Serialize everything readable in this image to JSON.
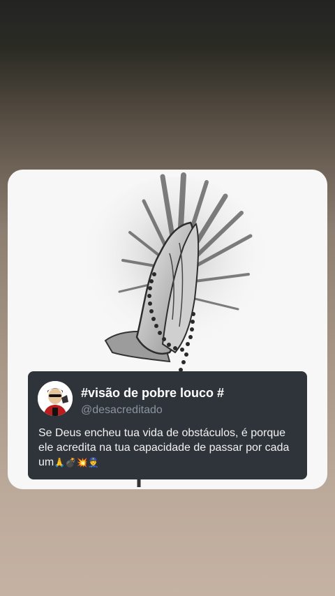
{
  "post": {
    "display_name": "#visão de pobre louco #",
    "handle": "@desacreditado",
    "text": "Se Deus encheu tua vida de obstáculos, é porque ele acredita na tua capacidade de passar por cada um",
    "emojis": "🙏💣💥👮"
  },
  "colors": {
    "card_bg": "#f7f7f7",
    "tweet_bg": "#2f343b",
    "handle": "#8c949d"
  },
  "icons": {
    "illustration": "praying-hands-with-rosary",
    "avatar": "cartoon-avatar"
  }
}
